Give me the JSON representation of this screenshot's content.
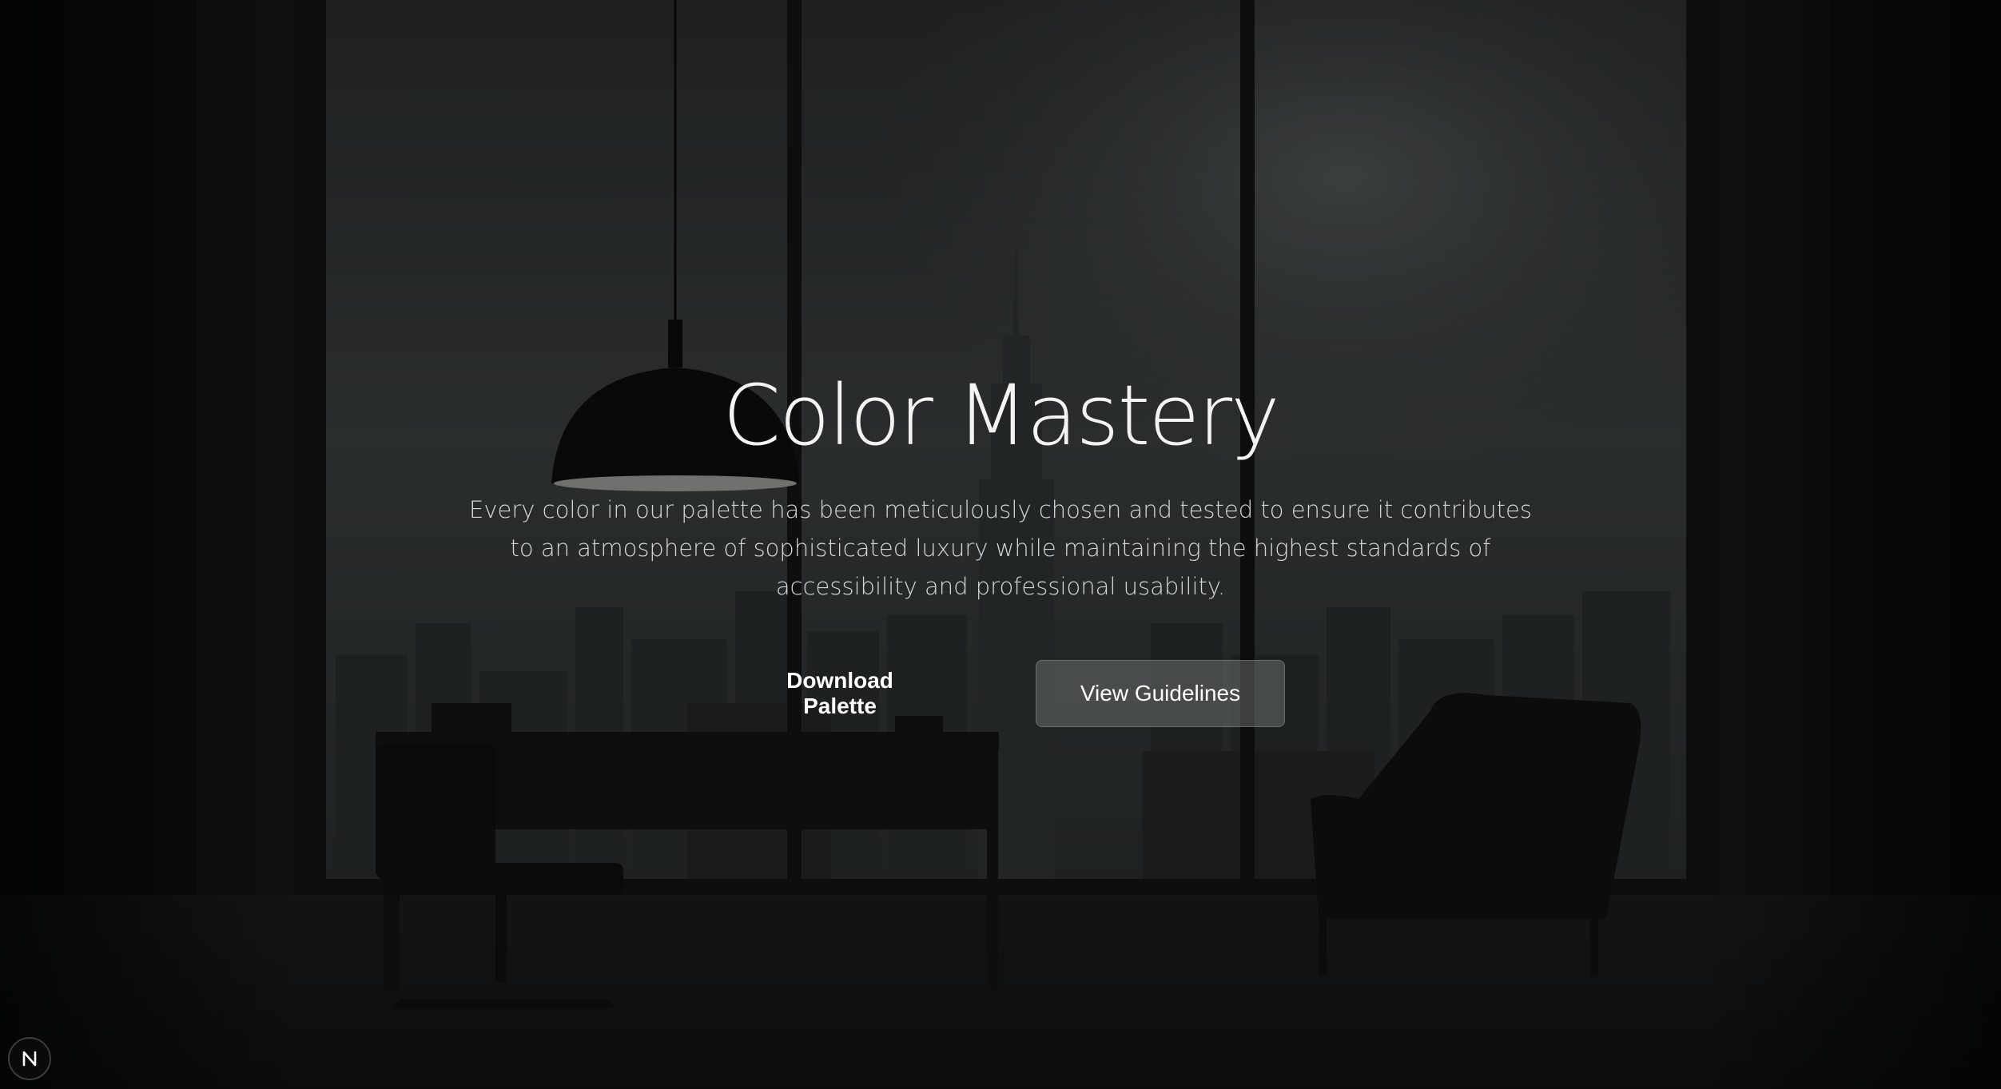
{
  "hero": {
    "title": "Color Mastery",
    "description": "Every color in our palette has been meticulously chosen and tested to ensure it contributes to an atmosphere of sophisticated luxury while maintaining the highest standards of accessibility and professional usability."
  },
  "actions": {
    "primary_label": "Download Palette",
    "secondary_label": "View Guidelines"
  },
  "badge": {
    "icon": "n-logo-icon"
  },
  "colors": {
    "background": "#0d0f0f",
    "text": "#f2f3f3",
    "button_secondary": "#5a5f5f"
  }
}
